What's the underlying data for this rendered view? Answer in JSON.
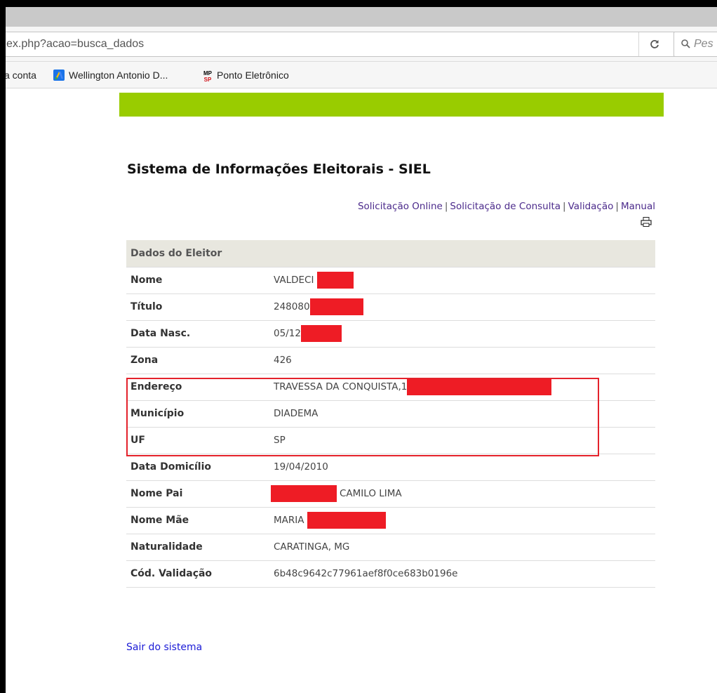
{
  "browser": {
    "url": "ex.php?acao=busca_dados",
    "reload_icon": "reload-icon",
    "search_placeholder": "Pes",
    "search_icon": "magnifier-icon"
  },
  "bookmarks": [
    {
      "label": "a conta",
      "icon": null
    },
    {
      "label": "Wellington Antonio D...",
      "icon": "google-ads-icon"
    },
    {
      "label": "Ponto Eletrônico",
      "icon": "mpsp-logo-icon",
      "icon_text_top": "MP",
      "icon_text_bottom": "SP"
    }
  ],
  "colors": {
    "accent_bar": "#99cc00",
    "link": "#4b2a8b",
    "logout_link": "#1a1ad6",
    "redaction": "#ee1c25",
    "highlight": "#e4222b",
    "table_header_bg": "#e8e7df"
  },
  "page": {
    "title": "Sistema de Informações Eleitorais - SIEL",
    "links": [
      "Solicitação Online",
      "Solicitação de Consulta",
      "Validação",
      "Manual"
    ],
    "link_separator": "|",
    "print_icon": "printer-icon",
    "logout": "Sair do sistema"
  },
  "table": {
    "header": "Dados do Eleitor",
    "rows": [
      {
        "label": "Nome",
        "value": "VALDECI",
        "redacted": true
      },
      {
        "label": "Título",
        "value": "248080",
        "redacted": true
      },
      {
        "label": "Data Nasc.",
        "value": "05/12",
        "redacted": true
      },
      {
        "label": "Zona",
        "value": "426",
        "redacted": false
      },
      {
        "label": "Endereço",
        "value": "TRAVESSA DA CONQUISTA,1",
        "redacted": true
      },
      {
        "label": "Município",
        "value": "DIADEMA",
        "redacted": false
      },
      {
        "label": "UF",
        "value": "SP",
        "redacted": false
      },
      {
        "label": "Data Domicílio",
        "value": "19/04/2010",
        "redacted": false
      },
      {
        "label": "Nome Pai",
        "value": "CAMILO LIMA",
        "redacted": true
      },
      {
        "label": "Nome Mãe",
        "value": "MARIA",
        "redacted": true
      },
      {
        "label": "Naturalidade",
        "value": "CARATINGA, MG",
        "redacted": false
      },
      {
        "label": "Cód. Validação",
        "value": "6b48c9642c77961aef8f0ce683b0196e",
        "redacted": false
      }
    ]
  }
}
